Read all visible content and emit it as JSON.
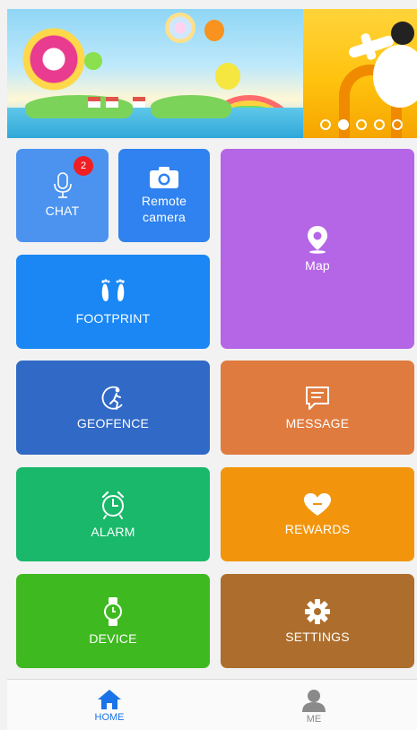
{
  "banner": {
    "slide_count": 5,
    "active_slide": 1
  },
  "tiles": {
    "chat": {
      "label": "CHAT",
      "badge": "2",
      "color": "#4c93f0",
      "icon": "microphone-icon"
    },
    "remote_camera": {
      "label_line1": "Remote",
      "label_line2": "camera",
      "color": "#2f82ef",
      "icon": "camera-icon"
    },
    "map": {
      "label": "Map",
      "color": "#b466e6",
      "icon": "map-pin-icon"
    },
    "footprint": {
      "label": "FOOTPRINT",
      "color": "#1a87f5",
      "icon": "footprints-icon"
    },
    "geofence": {
      "label": "GEOFENCE",
      "color": "#3169c6",
      "icon": "geofence-runner-icon"
    },
    "message": {
      "label": "MESSAGE",
      "color": "#df7b3f",
      "icon": "message-icon"
    },
    "alarm": {
      "label": "ALARM",
      "color": "#1ab86a",
      "icon": "alarm-clock-icon"
    },
    "rewards": {
      "label": "REWARDS",
      "color": "#f2950d",
      "icon": "heart-icon"
    },
    "device": {
      "label": "DEVICE",
      "color": "#3fb920",
      "icon": "watch-icon"
    },
    "settings": {
      "label": "SETTINGS",
      "color": "#ad6e2d",
      "icon": "gear-icon"
    }
  },
  "nav": {
    "home": {
      "label": "HOME",
      "color": "#1a73e8",
      "icon": "home-icon"
    },
    "me": {
      "label": "ME",
      "color": "#8a8a8a",
      "icon": "person-icon"
    }
  }
}
